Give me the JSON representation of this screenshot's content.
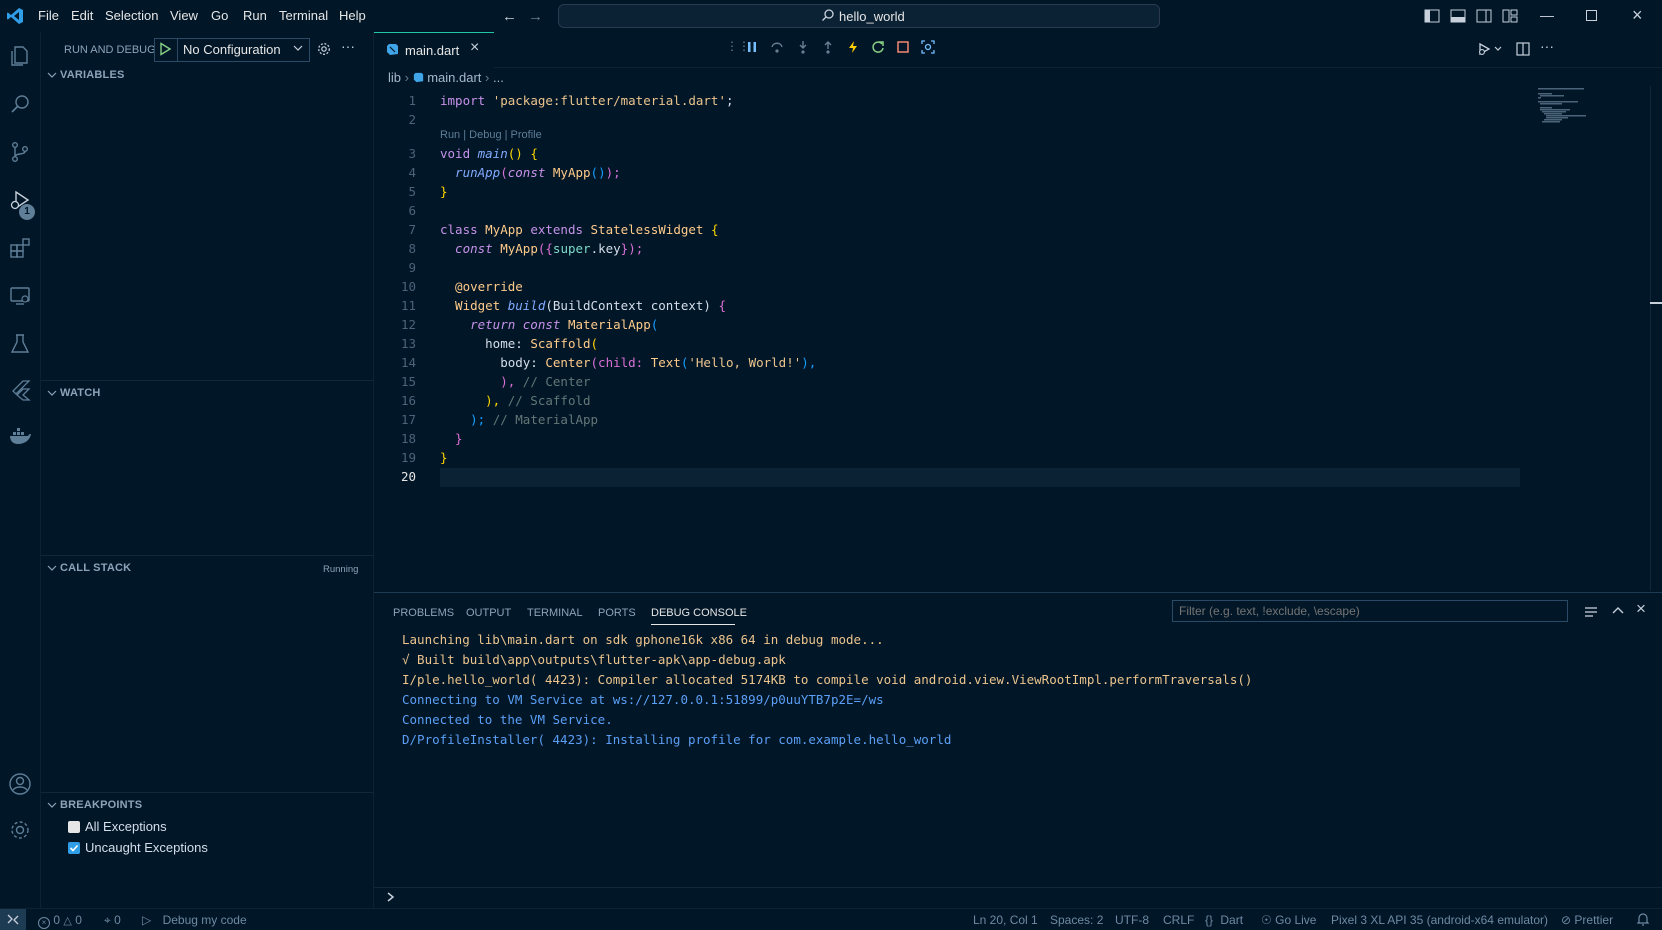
{
  "titlebar": {
    "menu": [
      "File",
      "Edit",
      "Selection",
      "View",
      "Go",
      "Run",
      "Terminal",
      "Help"
    ],
    "search_text": "hello_world"
  },
  "activity": {
    "debug_badge": "1"
  },
  "sidebar": {
    "title": "RUN AND DEBUG",
    "config": "No Configuration",
    "variables": "VARIABLES",
    "watch": "WATCH",
    "call_stack": "CALL STACK",
    "call_stack_status": "Running",
    "breakpoints": "BREAKPOINTS",
    "bp_all": "All Exceptions",
    "bp_uncaught": "Uncaught Exceptions"
  },
  "editor": {
    "tab": "main.dart",
    "breadcrumb_lib": "lib",
    "breadcrumb_file": "main.dart",
    "breadcrumb_more": "...",
    "codelens": "Run | Debug | Profile",
    "line_numbers": [
      "1",
      "2",
      "3",
      "4",
      "5",
      "6",
      "7",
      "8",
      "9",
      "10",
      "11",
      "12",
      "13",
      "14",
      "15",
      "16",
      "17",
      "18",
      "19",
      "20"
    ],
    "code": {
      "l1_a": "import ",
      "l1_b": "'package:flutter/material.dart'",
      "l1_c": ";",
      "l3_a": "void ",
      "l3_b": "main",
      "l3_c": "() {",
      "l4_a": "  runApp",
      "l4_b": "(",
      "l4_c": "const ",
      "l4_d": "MyApp",
      "l4_e": "()",
      "l4_f": ");",
      "l5": "}",
      "l7_a": "class ",
      "l7_b": "MyApp ",
      "l7_c": "extends ",
      "l7_d": "StatelessWidget ",
      "l7_e": "{",
      "l8_a": "  const ",
      "l8_b": "MyApp",
      "l8_c": "({",
      "l8_d": "super",
      "l8_e": ".key",
      "l8_f": "});",
      "l10": "  @override",
      "l11_a": "  Widget ",
      "l11_b": "build",
      "l11_c": "(BuildContext context) ",
      "l11_d": "{",
      "l12_a": "    return const ",
      "l12_b": "MaterialApp",
      "l12_c": "(",
      "l13_a": "      home: ",
      "l13_b": "Scaffold",
      "l13_c": "(",
      "l14_a": "        body: ",
      "l14_b": "Center",
      "l14_c": "(child: ",
      "l14_d": "Text",
      "l14_e": "(",
      "l14_f": "'Hello, World!'",
      "l14_g": "),",
      "l15_a": "        ), ",
      "l15_b": "// Center",
      "l16_a": "      ), ",
      "l16_b": "// Scaffold",
      "l17_a": "    ); ",
      "l17_b": "// MaterialApp",
      "l18": "  }",
      "l19": "}"
    }
  },
  "panel": {
    "tabs": [
      "PROBLEMS",
      "OUTPUT",
      "TERMINAL",
      "PORTS",
      "DEBUG CONSOLE"
    ],
    "filter_placeholder": "Filter (e.g. text, !exclude, \\escape)",
    "console": [
      "Launching lib\\main.dart on sdk gphone16k x86 64 in debug mode...",
      "√ Built build\\app\\outputs\\flutter-apk\\app-debug.apk",
      "I/ple.hello_world( 4423): Compiler allocated 5174KB to compile void android.view.ViewRootImpl.performTraversals()",
      "Connecting to VM Service at ws://127.0.0.1:51899/p0uuYTB7p2E=/ws",
      "Connected to the VM Service.",
      "D/ProfileInstaller( 4423): Installing profile for com.example.hello_world"
    ]
  },
  "statusbar": {
    "errors": "0",
    "warnings": "0",
    "ports": "0",
    "debug": "Debug my code",
    "position": "Ln 20, Col 1",
    "spaces": "Spaces: 2",
    "encoding": "UTF-8",
    "eol": "CRLF",
    "language": "Dart",
    "golive": "Go Live",
    "device": "Pixel 3 XL API 35 (android-x64 emulator)",
    "prettier": "Prettier"
  },
  "colors": {
    "background": "#011627",
    "accent": "#21c7a8",
    "console_yellow": "#ecc48d",
    "console_blue": "#5b9ff6"
  }
}
